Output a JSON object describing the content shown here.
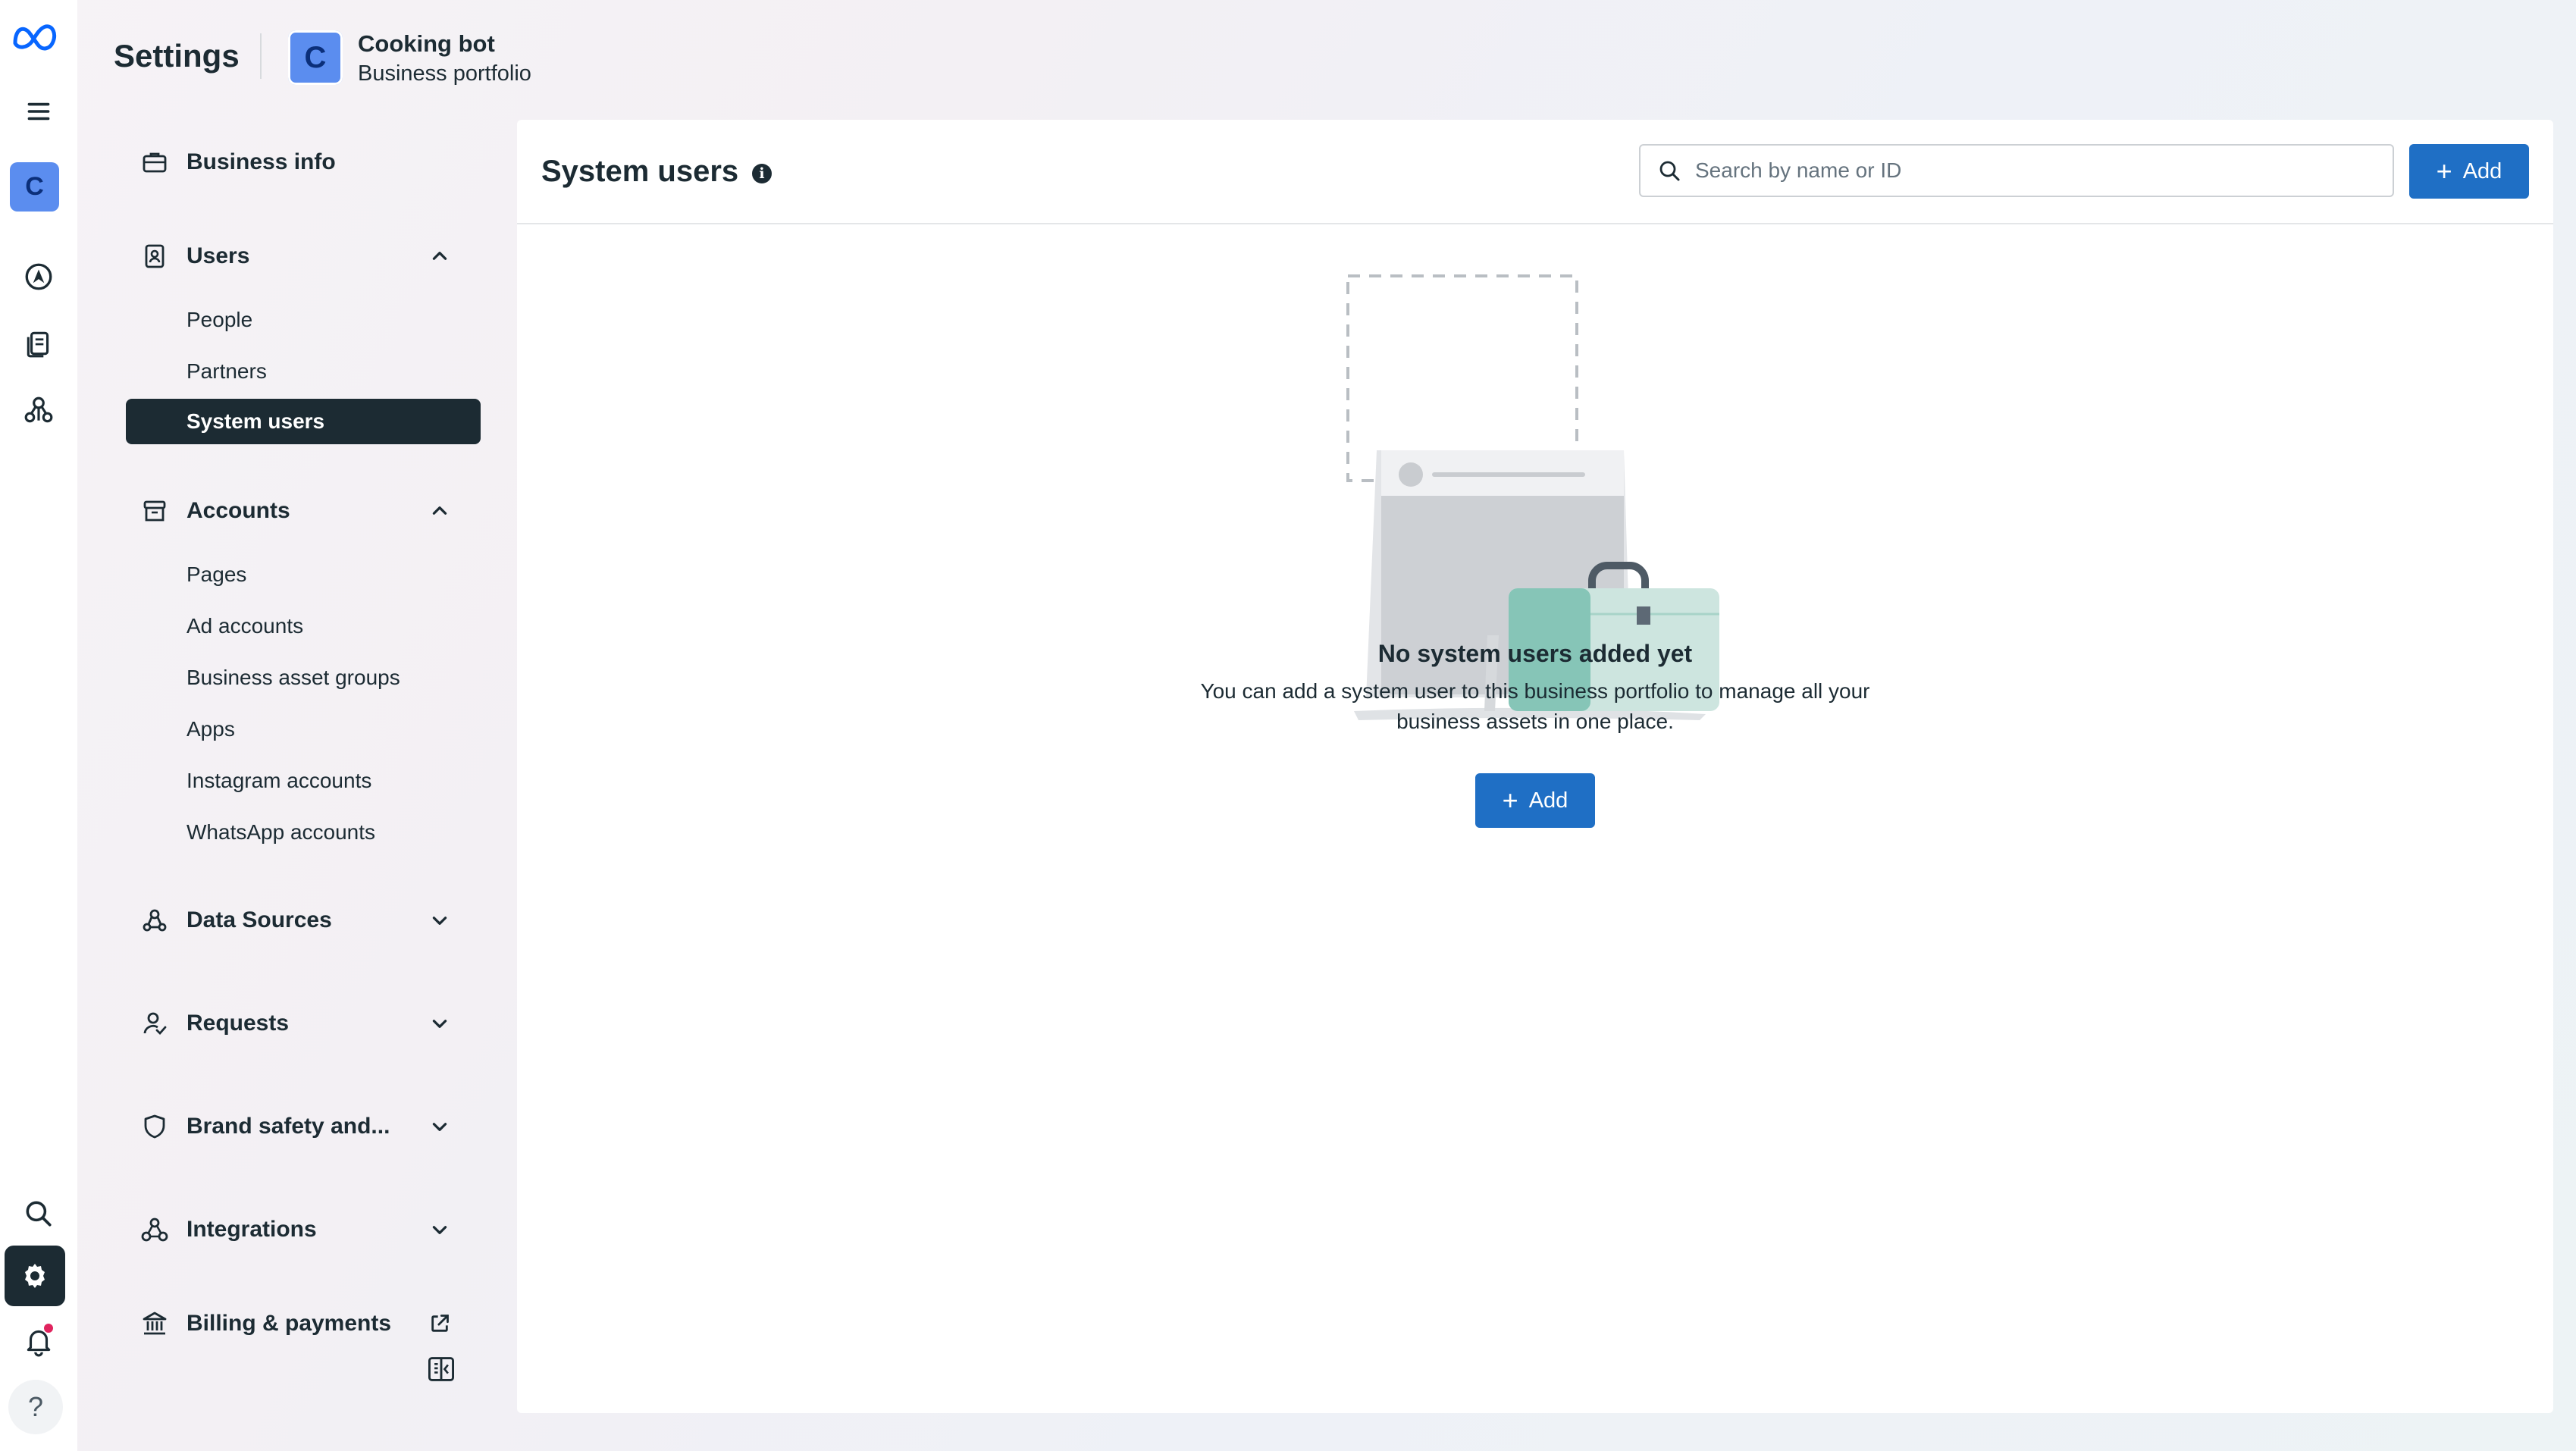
{
  "header": {
    "title": "Settings",
    "portfolio_initial": "C",
    "portfolio_name": "Cooking bot",
    "portfolio_type": "Business portfolio"
  },
  "rail": {
    "avatar_initial": "C",
    "help_label": "?",
    "icons": [
      "meta-logo-icon",
      "menu-icon",
      "compass-icon",
      "documents-icon",
      "network-icon",
      "search-icon",
      "gear-icon",
      "bell-icon",
      "help-icon"
    ]
  },
  "sidebar": {
    "business_info": "Business info",
    "users": {
      "label": "Users",
      "items": [
        "People",
        "Partners",
        "System users"
      ],
      "active": "System users"
    },
    "accounts": {
      "label": "Accounts",
      "items": [
        "Pages",
        "Ad accounts",
        "Business asset groups",
        "Apps",
        "Instagram accounts",
        "WhatsApp accounts"
      ]
    },
    "data_sources": "Data Sources",
    "requests": "Requests",
    "brand_safety": "Brand safety and...",
    "integrations": "Integrations",
    "billing": "Billing & payments"
  },
  "main": {
    "title": "System users",
    "search_placeholder": "Search by name or ID",
    "add_label": "Add",
    "empty_title": "No system users added yet",
    "empty_desc": "You can add a system user to this business portfolio to manage all your business assets in one place.",
    "empty_add_label": "Add"
  },
  "colors": {
    "primary_button": "#1f6fc5",
    "active_nav": "#1c2b33",
    "avatar": "#5b8def",
    "notification_dot": "#e0245e",
    "illustration_teal": "#86c5b7"
  }
}
